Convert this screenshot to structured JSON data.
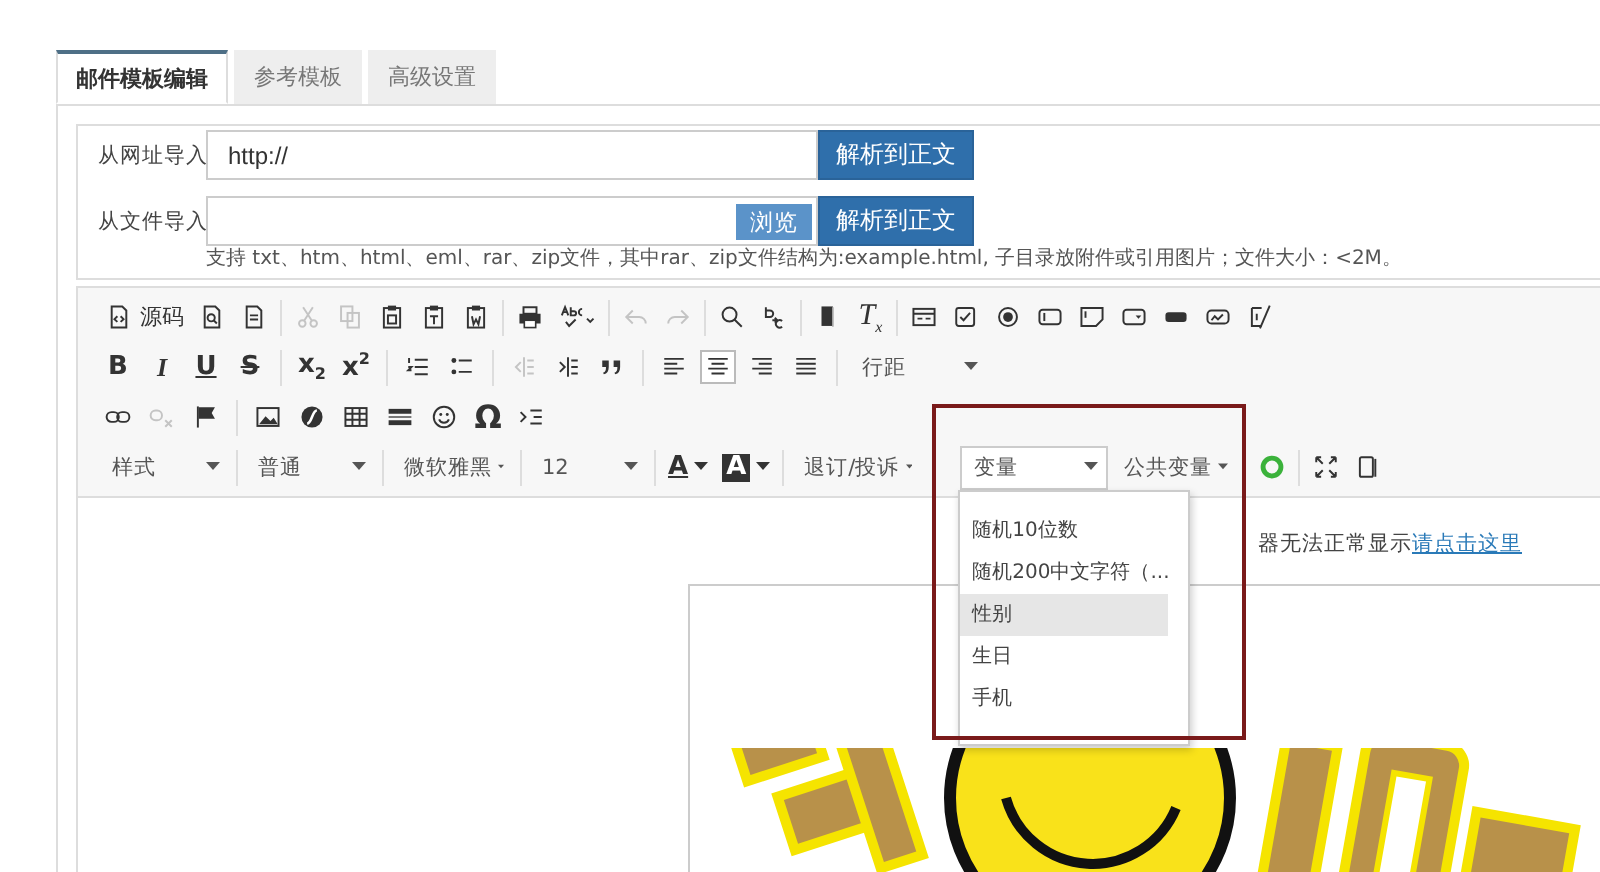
{
  "tabs": [
    {
      "label": "邮件模板编辑",
      "selected": true
    },
    {
      "label": "参考模板",
      "selected": false
    },
    {
      "label": "高级设置",
      "selected": false
    }
  ],
  "import": {
    "url_label": "从网址导入",
    "url_value": "http://",
    "url_button": "解析到正文",
    "file_label": "从文件导入",
    "browse_button": "浏览",
    "file_button": "解析到正文",
    "hint": "支持 txt、htm、html、eml、rar、zip文件，其中rar、zip文件结构为:example.html, 子目录放附件或引用图片；文件大小：<2M。"
  },
  "toolbar": {
    "rows": [
      {
        "items": [
          {
            "kind": "button",
            "label": "源码",
            "disabled": false
          },
          {
            "kind": "icon",
            "disabled": false
          },
          {
            "kind": "icon",
            "disabled": false
          },
          {
            "kind": "separator"
          },
          {
            "kind": "icon",
            "disabled": true
          },
          {
            "kind": "icon",
            "disabled": true
          },
          {
            "kind": "icon",
            "disabled": false
          },
          {
            "kind": "icon",
            "disabled": false
          },
          {
            "kind": "icon",
            "disabled": false
          },
          {
            "kind": "separator"
          },
          {
            "kind": "icon",
            "disabled": false
          },
          {
            "kind": "icon",
            "disabled": false
          },
          {
            "kind": "separator"
          },
          {
            "kind": "icon",
            "disabled": true
          },
          {
            "kind": "icon",
            "disabled": true
          },
          {
            "kind": "separator"
          },
          {
            "kind": "icon",
            "disabled": false
          },
          {
            "kind": "icon",
            "disabled": false
          },
          {
            "kind": "separator"
          },
          {
            "kind": "icon",
            "disabled": false
          },
          {
            "kind": "icon",
            "label": "T$_{x}$",
            "disabled": false
          },
          {
            "kind": "separator"
          },
          {
            "kind": "icon",
            "disabled": false
          },
          {
            "kind": "icon",
            "disabled": false
          },
          {
            "kind": "icon",
            "disabled": false
          },
          {
            "kind": "icon",
            "disabled": false
          },
          {
            "kind": "icon",
            "disabled": false
          },
          {
            "kind": "icon",
            "disabled": false
          },
          {
            "kind": "icon",
            "disabled": false
          },
          {
            "kind": "icon",
            "disabled": false
          },
          {
            "kind": "icon",
            "disabled": false
          }
        ]
      },
      {
        "items": [
          {
            "kind": "icon",
            "label": "B",
            "disabled": false
          },
          {
            "kind": "icon",
            "label": "I",
            "disabled": false
          },
          {
            "kind": "icon",
            "label": "U",
            "disabled": false
          },
          {
            "kind": "icon",
            "label": "S",
            "disabled": false
          },
          {
            "kind": "separator"
          },
          {
            "kind": "icon",
            "label": "x$_{2}$",
            "disabled": false
          },
          {
            "kind": "icon",
            "label": "x$^{2}$",
            "disabled": false
          },
          {
            "kind": "separator"
          },
          {
            "kind": "icon",
            "disabled": false
          },
          {
            "kind": "icon",
            "disabled": false
          },
          {
            "kind": "separator"
          },
          {
            "kind": "icon",
            "disabled": true
          },
          {
            "kind": "icon",
            "disabled": false
          },
          {
            "kind": "icon",
            "disabled": false
          },
          {
            "kind": "separator"
          },
          {
            "kind": "icon",
            "disabled": false,
            "selected": false
          },
          {
            "kind": "icon",
            "disabled": false,
            "selected": true
          },
          {
            "kind": "icon",
            "disabled": false,
            "selected": false
          },
          {
            "kind": "icon",
            "disabled": false,
            "selected": false
          },
          {
            "kind": "separator"
          },
          {
            "kind": "dropdown",
            "label": "行距",
            "open": false
          }
        ]
      },
      {
        "items": [
          {
            "kind": "icon",
            "disabled": false
          },
          {
            "kind": "icon",
            "disabled": true
          },
          {
            "kind": "icon",
            "disabled": false
          },
          {
            "kind": "separator"
          },
          {
            "kind": "icon",
            "disabled": false
          },
          {
            "kind": "icon",
            "disabled": false
          },
          {
            "kind": "icon",
            "disabled": false
          },
          {
            "kind": "icon",
            "disabled": false
          },
          {
            "kind": "icon",
            "disabled": false
          },
          {
            "kind": "icon",
            "label": "Ω",
            "disabled": false
          },
          {
            "kind": "icon",
            "disabled": false
          }
        ]
      },
      {
        "items": [
          {
            "kind": "dropdown",
            "label": "样式",
            "open": false
          },
          {
            "kind": "separator"
          },
          {
            "kind": "dropdown",
            "label": "普通",
            "open": false
          },
          {
            "kind": "separator"
          },
          {
            "kind": "dropdown",
            "label": "微软雅黑",
            "open": false
          },
          {
            "kind": "separator"
          },
          {
            "kind": "dropdown",
            "label": "12",
            "open": false
          },
          {
            "kind": "separator"
          },
          {
            "kind": "icon",
            "label": "A",
            "disabled": false
          },
          {
            "kind": "icon",
            "label": "A",
            "disabled": false
          },
          {
            "kind": "separator"
          },
          {
            "kind": "dropdown",
            "label": "退订/投诉",
            "open": false
          },
          {
            "kind": "dropdown",
            "label": "变量",
            "open": true
          },
          {
            "kind": "dropdown",
            "label": "公共变量",
            "open": false
          },
          {
            "kind": "separator"
          },
          {
            "kind": "icon",
            "disabled": false
          },
          {
            "kind": "separator"
          },
          {
            "kind": "icon",
            "disabled": false
          },
          {
            "kind": "icon",
            "disabled": false
          }
        ]
      }
    ]
  },
  "variable_menu": {
    "items": [
      {
        "label": "随机10位数",
        "selected": false
      },
      {
        "label": "随机200中文字符（...",
        "selected": false
      },
      {
        "label": "性别",
        "selected": true
      },
      {
        "label": "生日",
        "selected": false
      },
      {
        "label": "手机",
        "selected": false
      }
    ]
  },
  "editor": {
    "notice": "器无法正常显示",
    "notice_link": "请点击这里"
  }
}
